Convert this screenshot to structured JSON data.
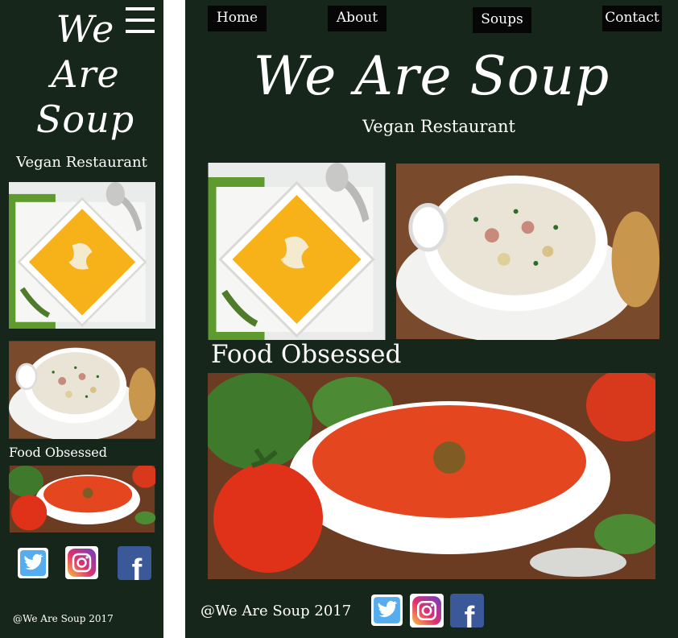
{
  "mobile": {
    "title_line1": "We",
    "title_line2": "Are",
    "title_line3": "Soup",
    "subtitle": "Vegan Restaurant",
    "section_heading": "Food Obsessed",
    "copyright": "@We Are Soup 2017"
  },
  "desktop": {
    "nav": {
      "home": "Home",
      "about": "About",
      "soups": "Soups",
      "contact": "Contact"
    },
    "title": "We Are Soup",
    "subtitle": "Vegan Restaurant",
    "section_heading": "Food Obsessed",
    "copyright": "@We Are Soup 2017"
  },
  "social": {
    "twitter_icon": "twitter-icon",
    "instagram_icon": "instagram-icon",
    "facebook_icon": "facebook-icon",
    "facebook_letter": "f"
  },
  "colors": {
    "background": "#17261a",
    "nav_button": "#050605",
    "text": "#ffffff",
    "twitter": "#55acee",
    "facebook": "#3b5998"
  }
}
